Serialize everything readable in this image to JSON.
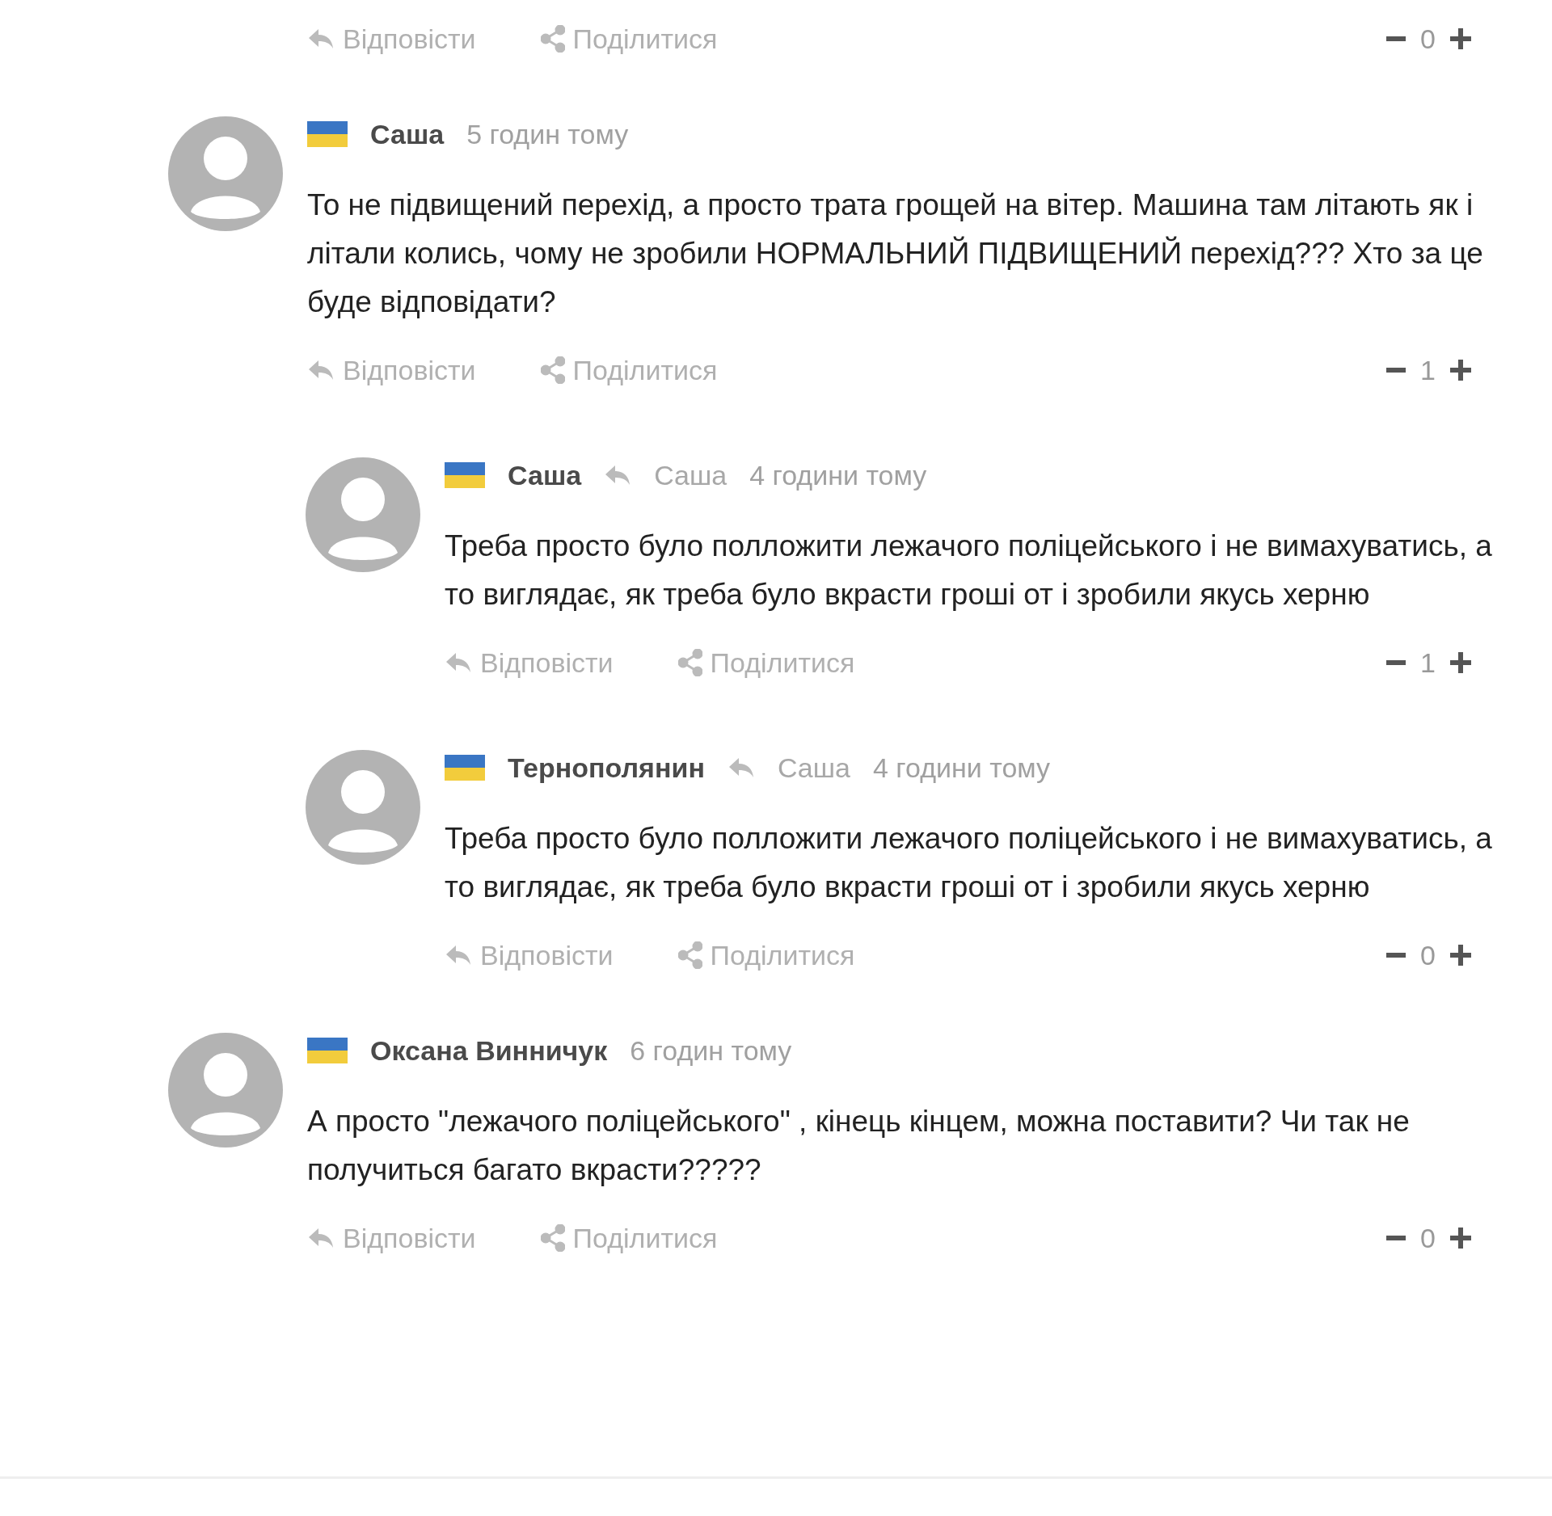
{
  "top_actions": {
    "reply_label": "Відповісти",
    "share_label": "Поділитися",
    "score": "0"
  },
  "comments": [
    {
      "author": "Саша",
      "time": "5 годин тому",
      "text": "То не підвищений перехід, а просто трата грощей на вітер. Машина там літають як і літали колись, чому не зробили НОРМАЛЬНИЙ ПІДВИЩЕНИЙ перехід??? Хто за це буде відповідати?",
      "reply_label": "Відповісти",
      "share_label": "Поділитися",
      "score": "1",
      "replies": [
        {
          "author": "Саша",
          "reply_to": "Саша",
          "time": "4 години тому",
          "text": "Треба просто було полложити лежачого поліцейського і не вимахуватись, а то виглядає, як треба було вкрасти гроші от і зробили якусь херню",
          "reply_label": "Відповісти",
          "share_label": "Поділитися",
          "score": "1"
        },
        {
          "author": "Тернополянин",
          "reply_to": "Саша",
          "time": "4 години тому",
          "text": "Треба просто було полложити лежачого поліцейського і не вимахуватись, а то виглядає, як треба було вкрасти гроші от і зробили якусь херню",
          "reply_label": "Відповісти",
          "share_label": "Поділитися",
          "score": "0"
        }
      ]
    },
    {
      "author": "Оксана Винничук",
      "time": "6 годин тому",
      "text": "А просто \"лежачого поліцейського\" , кінець кінцем, можна поставити? Чи так не получиться багато вкрасти?????",
      "reply_label": "Відповісти",
      "share_label": "Поділитися",
      "score": "0"
    }
  ]
}
